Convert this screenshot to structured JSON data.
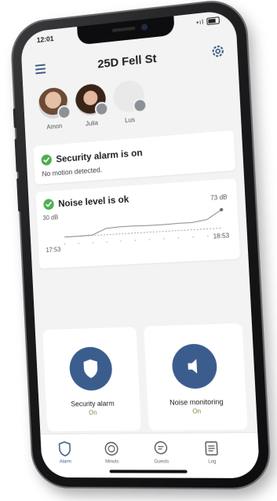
{
  "status": {
    "time": "12:01",
    "signal": "•ıl"
  },
  "header": {
    "title": "25D Fell St"
  },
  "users": [
    {
      "name": "Amon"
    },
    {
      "name": "Julia"
    },
    {
      "name": "Lus"
    }
  ],
  "security_card": {
    "title": "Security alarm is on",
    "subtitle": "No motion detected."
  },
  "noise_card": {
    "title": "Noise level is ok",
    "threshold_label": "30 dB",
    "current_label": "73 dB",
    "start_time": "17:53",
    "end_time": "18:53"
  },
  "chart_data": {
    "type": "line",
    "x": [
      "17:53",
      "18:53"
    ],
    "series": [
      {
        "values": [
          30,
          30,
          31,
          45,
          47,
          47,
          46,
          46,
          47,
          47,
          52,
          73
        ]
      }
    ],
    "annotations": [
      "30 dB",
      "73 dB"
    ],
    "grid": false
  },
  "tiles": [
    {
      "label": "Security alarm",
      "state": "On",
      "icon": "shield-icon"
    },
    {
      "label": "Noise monitoring",
      "state": "On",
      "icon": "speaker-icon"
    }
  ],
  "tabs": [
    {
      "label": "Alarm",
      "icon": "shield-icon",
      "active": true
    },
    {
      "label": "Minuts",
      "icon": "minut-device-icon"
    },
    {
      "label": "Guests",
      "icon": "chat-icon"
    },
    {
      "label": "Log",
      "icon": "list-icon"
    }
  ],
  "colors": {
    "accent": "#3b5d8e",
    "check": "#4caf50",
    "state_on": "#7a8c3a"
  }
}
